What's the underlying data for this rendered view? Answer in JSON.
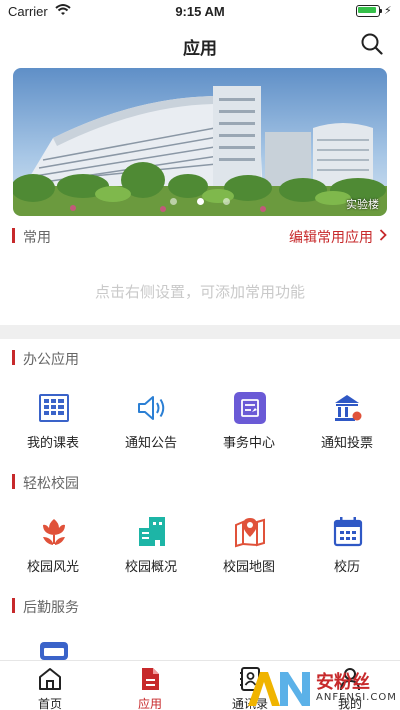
{
  "status_bar": {
    "carrier": "Carrier",
    "time": "9:15 AM",
    "battery_level": 0.9
  },
  "navbar": {
    "title": "应用",
    "search_icon": "search-icon"
  },
  "banner": {
    "caption": "实验楼",
    "pages": 3,
    "active_page": 2
  },
  "common": {
    "title": "常用",
    "edit_link": "编辑常用应用",
    "empty_hint": "点击右侧设置，可添加常用功能"
  },
  "office": {
    "title": "办公应用",
    "items": [
      {
        "label": "我的课表",
        "icon": "calendar-grid-icon",
        "color": "#3a63c9"
      },
      {
        "label": "通知公告",
        "icon": "speaker-icon",
        "color": "#2b7fd4"
      },
      {
        "label": "事务中心",
        "icon": "task-board-icon",
        "color": "#6a5ad6"
      },
      {
        "label": "通知投票",
        "icon": "vote-building-icon",
        "color": "#2f58c5"
      }
    ]
  },
  "campus": {
    "title": "轻松校园",
    "items": [
      {
        "label": "校园风光",
        "icon": "flower-icon",
        "color": "#e0523a"
      },
      {
        "label": "校园概况",
        "icon": "buildings-icon",
        "color": "#1db5a6"
      },
      {
        "label": "校园地图",
        "icon": "map-pin-icon",
        "color": "#e0523a"
      },
      {
        "label": "校历",
        "icon": "calendar-icon",
        "color": "#2f58c5"
      }
    ]
  },
  "logistics": {
    "title": "后勤服务"
  },
  "tabbar": {
    "items": [
      {
        "label": "首页",
        "icon": "home-icon"
      },
      {
        "label": "应用",
        "icon": "document-icon",
        "active": true
      },
      {
        "label": "通讯录",
        "icon": "contacts-icon"
      },
      {
        "label": "我的",
        "icon": "user-icon"
      }
    ]
  },
  "watermark": {
    "text": "安粉丝",
    "sub": "ANFENSI.COM"
  },
  "colors": {
    "accent": "#c7292b",
    "hint": "#c9c9c9",
    "separator": "#efefef"
  }
}
